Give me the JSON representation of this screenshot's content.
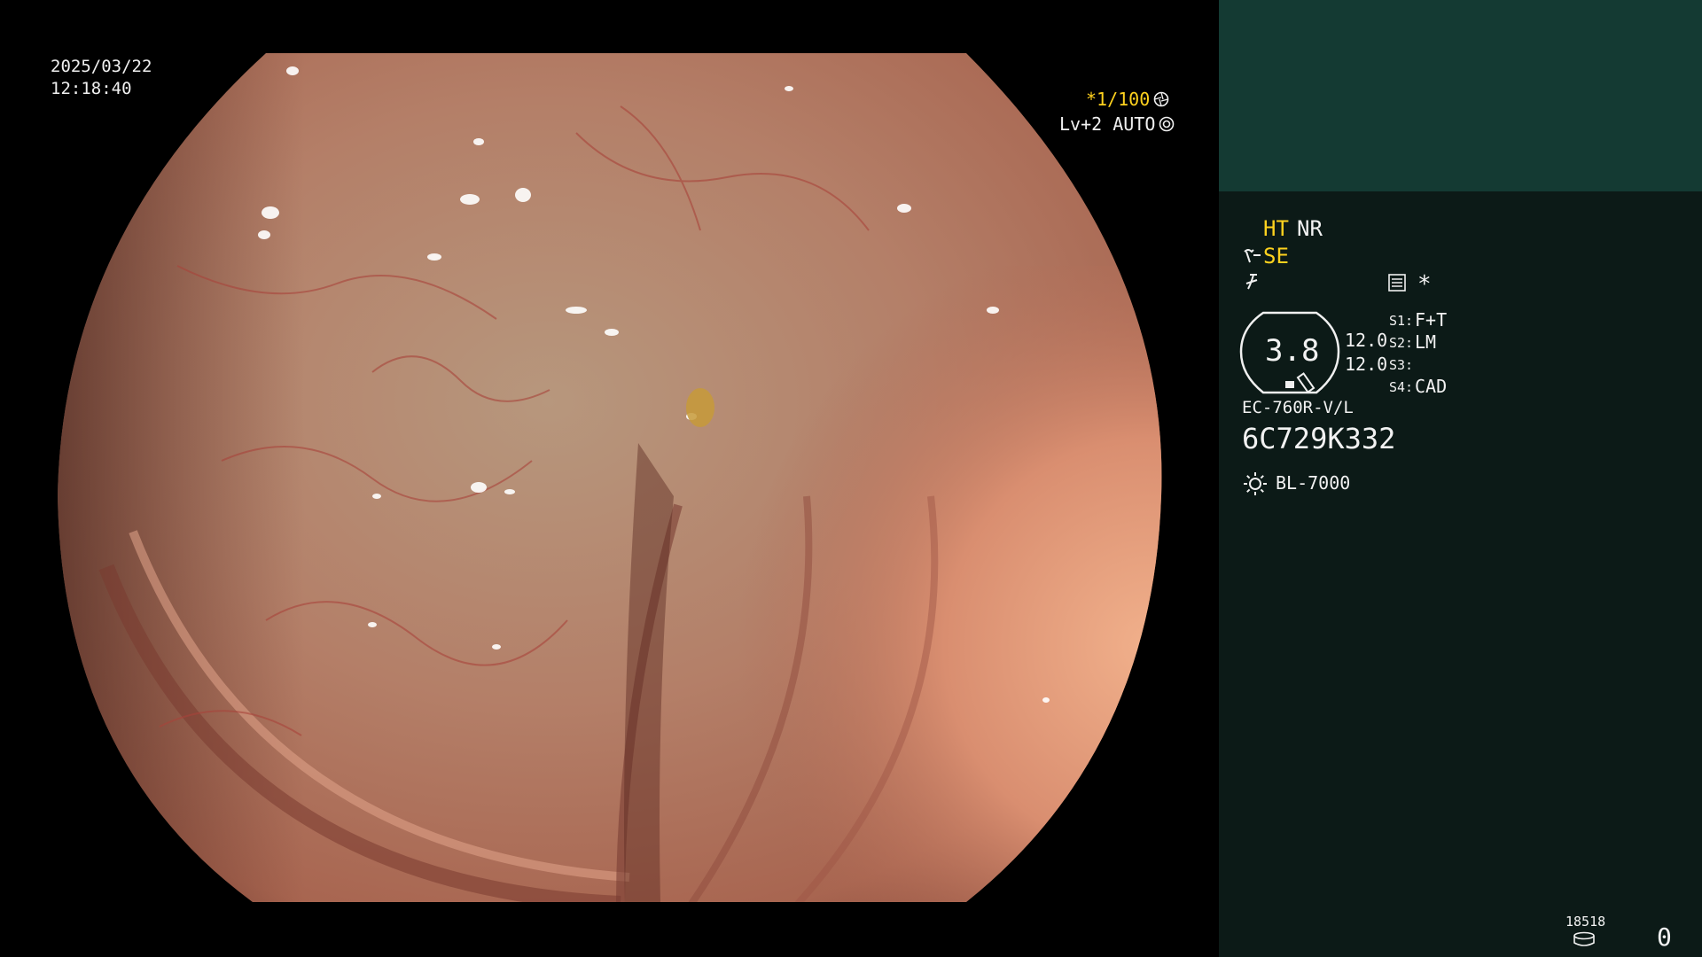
{
  "overlay": {
    "date": "2025/03/22",
    "time": "12:18:40",
    "shutter": "*1/100",
    "level_auto": "Lv+2 AUTO",
    "shutter_icon": "aperture-icon",
    "auto_icon": "iris-icon"
  },
  "panel": {
    "ht_label": "HT",
    "nr_label": "NR",
    "se_label": "SE",
    "star_label": "*",
    "zoom_value": "3.8",
    "value_1": "12.0",
    "value_2": "12.0",
    "s1": "S1:",
    "s1_value": "F+T",
    "s2": "S2:",
    "s2_value": "LM",
    "s3": "S3:",
    "s3_value": "",
    "s4": "S4:",
    "s4_value": "CAD",
    "scope_model": "EC-760R-V/L",
    "serial": "6C729K332",
    "light_source": "BL-7000",
    "counter": "18518",
    "count_value": "0"
  },
  "colors": {
    "panel_bg": "#0c1a17",
    "panel_top": "#143a33",
    "accent": "#ffd21e"
  }
}
